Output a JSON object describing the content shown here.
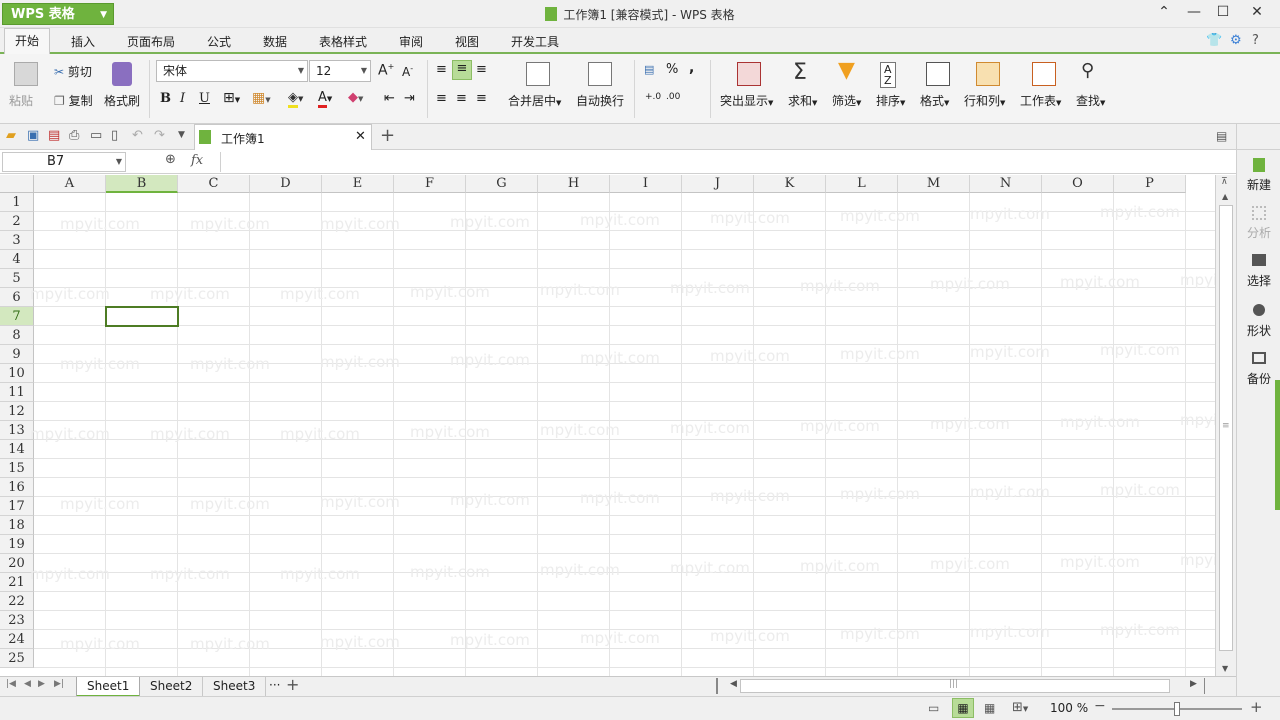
{
  "app": {
    "name": "WPS 表格",
    "window_title": "工作簿1 [兼容模式] - WPS 表格"
  },
  "menu": {
    "tabs": [
      "开始",
      "插入",
      "页面布局",
      "公式",
      "数据",
      "表格样式",
      "审阅",
      "视图",
      "开发工具"
    ],
    "active": "开始"
  },
  "ribbon": {
    "paste": "粘贴",
    "cut": "剪切",
    "copy": "复制",
    "format_painter": "格式刷",
    "font_name": "宋体",
    "font_size": "12",
    "merge_center": "合并居中",
    "wrap_text": "自动换行",
    "percent": "%",
    "comma": ",",
    "highlight": "突出显示",
    "sum": "求和",
    "filter": "筛选",
    "sort": "排序",
    "format": "格式",
    "rows_cols": "行和列",
    "worksheet": "工作表",
    "find": "查找"
  },
  "doc_tab": {
    "name": "工作簿1"
  },
  "formula_bar": {
    "cell_ref": "B7",
    "fx": "fx",
    "content": ""
  },
  "grid": {
    "columns": [
      "A",
      "B",
      "C",
      "D",
      "E",
      "F",
      "G",
      "H",
      "I",
      "J",
      "K",
      "L",
      "M",
      "N",
      "O",
      "P"
    ],
    "rows": [
      "1",
      "2",
      "3",
      "4",
      "5",
      "6",
      "7",
      "8",
      "9",
      "10",
      "11",
      "12",
      "13",
      "14",
      "15",
      "16",
      "17",
      "18",
      "19",
      "20",
      "21",
      "22",
      "23",
      "24",
      "25"
    ],
    "selected_col": "B",
    "selected_row": "7"
  },
  "sidebar": {
    "items": [
      "新建",
      "分析",
      "选择",
      "形状",
      "备份"
    ]
  },
  "sheets": {
    "tabs": [
      "Sheet1",
      "Sheet2",
      "Sheet3"
    ],
    "active": "Sheet1",
    "more": "···"
  },
  "status": {
    "zoom": "100 %",
    "zoom_fraction": 0.5
  },
  "watermark": "mpyit.com",
  "colors": {
    "accent": "#6fb33e",
    "selection": "#4d7c24"
  }
}
